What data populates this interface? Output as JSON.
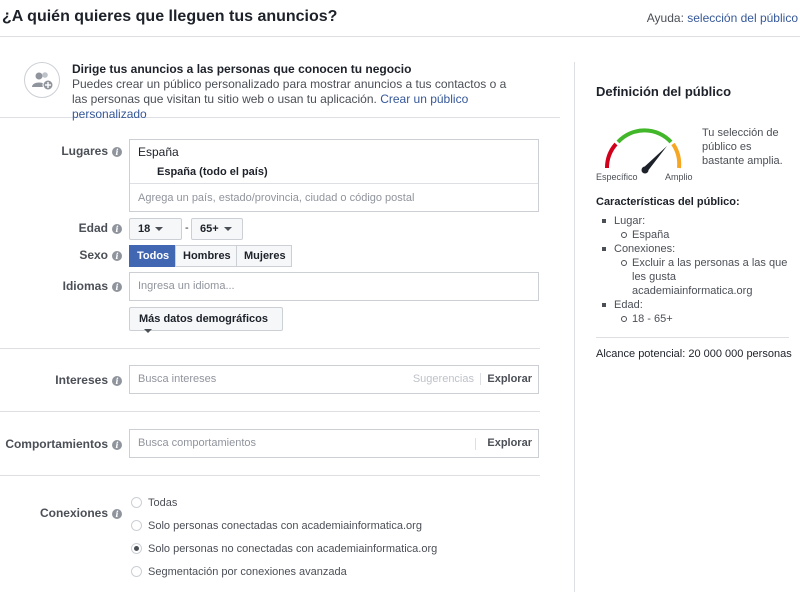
{
  "header": {
    "title": "¿A quién quieres que lleguen tus anuncios?",
    "help_prefix": "Ayuda: ",
    "help_link": "selección del público"
  },
  "intro": {
    "heading": "Dirige tus anuncios a las personas que conocen tu negocio",
    "body": "Puedes crear un público personalizado para mostrar anuncios a tus contactos o a las personas que visitan tu sitio web o usan tu aplicación. ",
    "link": "Crear un público personalizado"
  },
  "form": {
    "lugares": {
      "label": "Lugares",
      "country": "España",
      "scope": "España (todo el país)",
      "placeholder": "Agrega un país, estado/provincia, ciudad o código postal"
    },
    "edad": {
      "label": "Edad",
      "min": "18",
      "dash": "-",
      "max": "65+"
    },
    "sexo": {
      "label": "Sexo",
      "options": [
        "Todos",
        "Hombres",
        "Mujeres"
      ],
      "selected": "Todos"
    },
    "idiomas": {
      "label": "Idiomas",
      "placeholder": "Ingresa un idioma..."
    },
    "more_demographics": "Más datos demográficos",
    "intereses": {
      "label": "Intereses",
      "placeholder": "Busca intereses",
      "suggestions": "Sugerencias",
      "explore": "Explorar"
    },
    "comportamientos": {
      "label": "Comportamientos",
      "placeholder": "Busca comportamientos",
      "explore": "Explorar"
    },
    "conexiones": {
      "label": "Conexiones",
      "options": [
        "Todas",
        "Solo personas conectadas con academiainformatica.org",
        "Solo personas no conectadas con academiainformatica.org",
        "Segmentación por conexiones avanzada"
      ],
      "selected_index": 2
    }
  },
  "panel": {
    "title": "Definición del público",
    "gauge_left": "Específico",
    "gauge_right": "Amplio",
    "gauge_text": "Tu selección de público es bastante amplia.",
    "characteristics_title": "Características del público:",
    "items": [
      {
        "label": "Lugar:",
        "sub": [
          "España"
        ]
      },
      {
        "label": "Conexiones:",
        "sub": [
          "Excluir a las personas a las que les gusta academiainformatica.org"
        ]
      },
      {
        "label": "Edad:",
        "sub": [
          "18 - 65+"
        ]
      }
    ],
    "reach": "Alcance potencial: 20 000 000 personas"
  },
  "colors": {
    "accent": "#4267b2",
    "link": "#365899",
    "gauge_red": "#d0021b",
    "gauge_green": "#42b72a",
    "gauge_orange": "#f5a623"
  }
}
